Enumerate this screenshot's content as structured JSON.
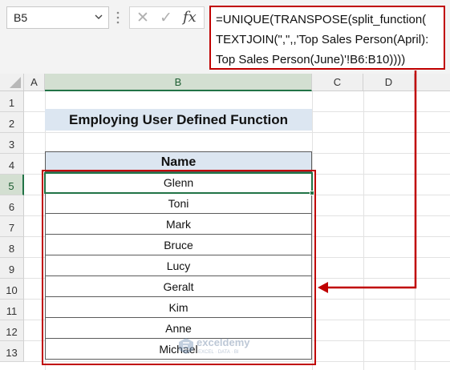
{
  "name_box": {
    "value": "B5"
  },
  "formula_bar": {
    "cancel_glyph": "✕",
    "enter_glyph": "✓",
    "fx_label": "fx",
    "lines": [
      "=UNIQUE(TRANSPOSE(split_function(",
      "TEXTJOIN(\",\",,'Top Sales Person(April):",
      "Top Sales Person(June)'!B6:B10))))"
    ]
  },
  "columns": [
    "A",
    "B",
    "C",
    "D"
  ],
  "rows": [
    "1",
    "2",
    "3",
    "4",
    "5",
    "6",
    "7",
    "8",
    "9",
    "10",
    "11",
    "12",
    "13"
  ],
  "sheet": {
    "title": "Employing User Defined Function",
    "table_header": "Name",
    "names": [
      "Glenn",
      "Toni",
      "Mark",
      "Bruce",
      "Lucy",
      "Geralt",
      "Kim",
      "Anne",
      "Michael"
    ]
  },
  "watermark": {
    "brand": "exceldemy",
    "tagline": "EXCEL · DATA · BI"
  },
  "colors": {
    "accent_red": "#c00000",
    "excel_green": "#217346",
    "header_fill": "#dce6f1"
  }
}
